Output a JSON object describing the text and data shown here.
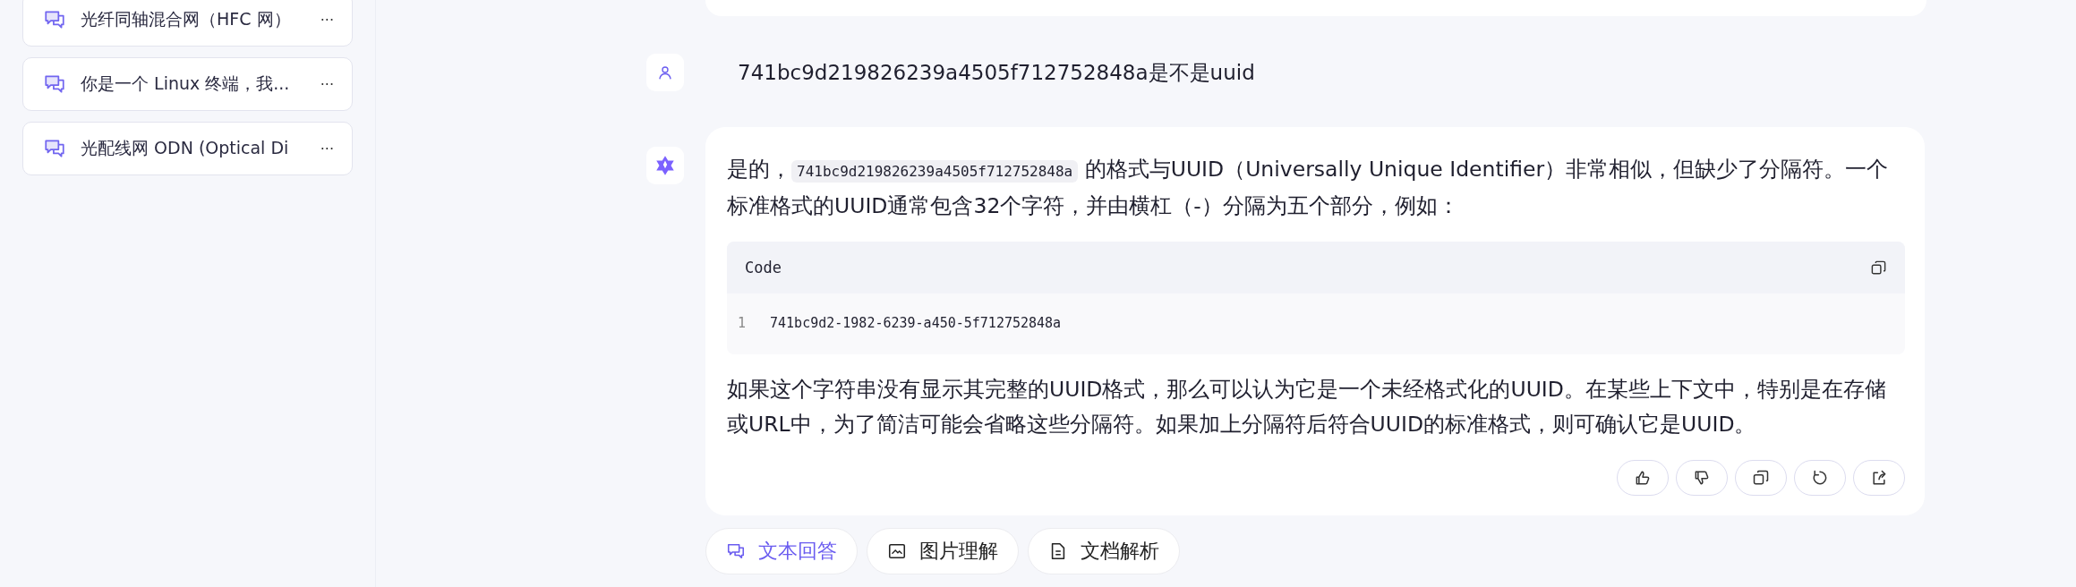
{
  "sidebar": {
    "items": [
      {
        "title": "光纤同轴混合网（HFC 网）",
        "more": "···"
      },
      {
        "title": "你是一个 Linux 终端，我...",
        "more": "···"
      },
      {
        "title": "光配线网 ODN (Optical Di",
        "more": "···"
      }
    ]
  },
  "chat": {
    "user_message": "741bc9d219826239a4505f712752848a是不是uuid",
    "answer": {
      "intro_before": "是的，",
      "inline_code": "741bc9d219826239a4505f712752848a",
      "intro_after": "的格式与UUID（Universally Unique Identifier）非常相似，但缺少了分隔符。一个标准格式的UUID通常包含32个字符，并由横杠（-）分隔为五个部分，例如：",
      "code_block": {
        "label": "Code",
        "lines": [
          {
            "number": "1",
            "text": "741bc9d2-1982-6239-a450-5f712752848a"
          }
        ]
      },
      "closing": "如果这个字符串没有显示其完整的UUID格式，那么可以认为它是一个未经格式化的UUID。在某些上下文中，特别是在存储或URL中，为了简洁可能会省略这些分隔符。如果加上分隔符后符合UUID的标准格式，则可确认它是UUID。",
      "actions": [
        {
          "kind": "like"
        },
        {
          "kind": "dislike"
        },
        {
          "kind": "copy"
        },
        {
          "kind": "regenerate"
        },
        {
          "kind": "share"
        }
      ]
    }
  },
  "modes": [
    {
      "kind": "text",
      "label": "文本回答",
      "selected": true
    },
    {
      "kind": "image",
      "label": "图片理解",
      "selected": false
    },
    {
      "kind": "document",
      "label": "文档解析",
      "selected": false
    }
  ]
}
